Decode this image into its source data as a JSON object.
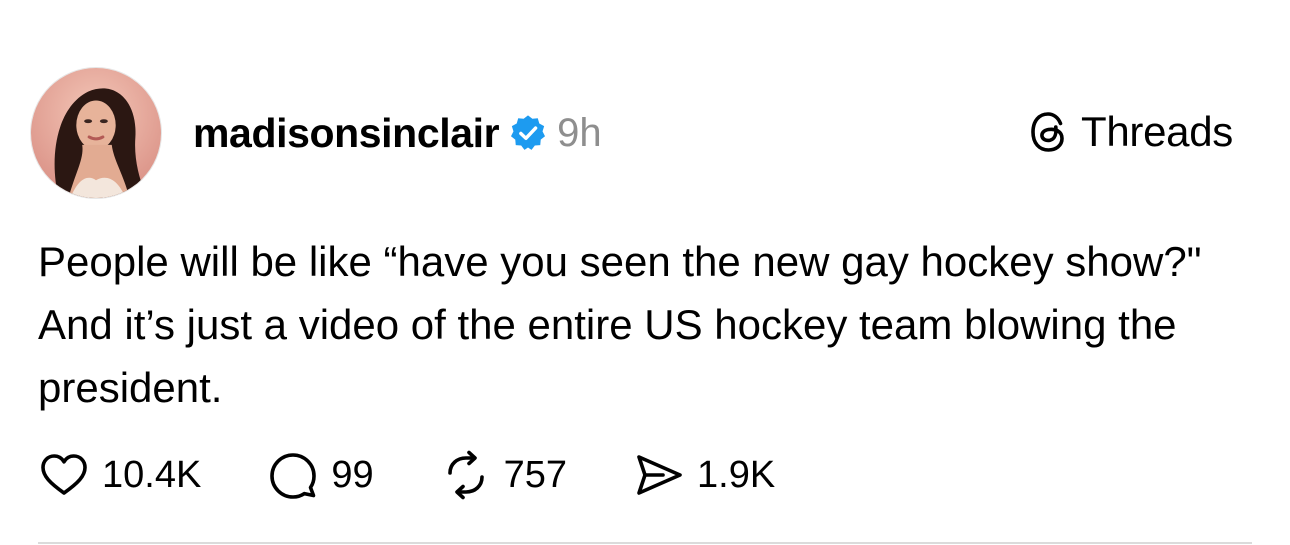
{
  "post": {
    "username": "madisonsinclair",
    "time": "9h",
    "text": "People will be like “have you seen the new gay hockey show?\" And it’s just a video of the entire US hockey team blowing the president.",
    "verified_badge": "verified-check-icon",
    "avatar": "profile-photo"
  },
  "brand": {
    "name": "Threads",
    "logo": "threads-logo-icon"
  },
  "actions": {
    "likes": "10.4K",
    "replies": "99",
    "reposts": "757",
    "shares": "1.9K"
  },
  "colors": {
    "verified": "#1d9bf0",
    "muted_text": "#8e8e8e",
    "text": "#000000",
    "divider": "#dbdbdb"
  }
}
